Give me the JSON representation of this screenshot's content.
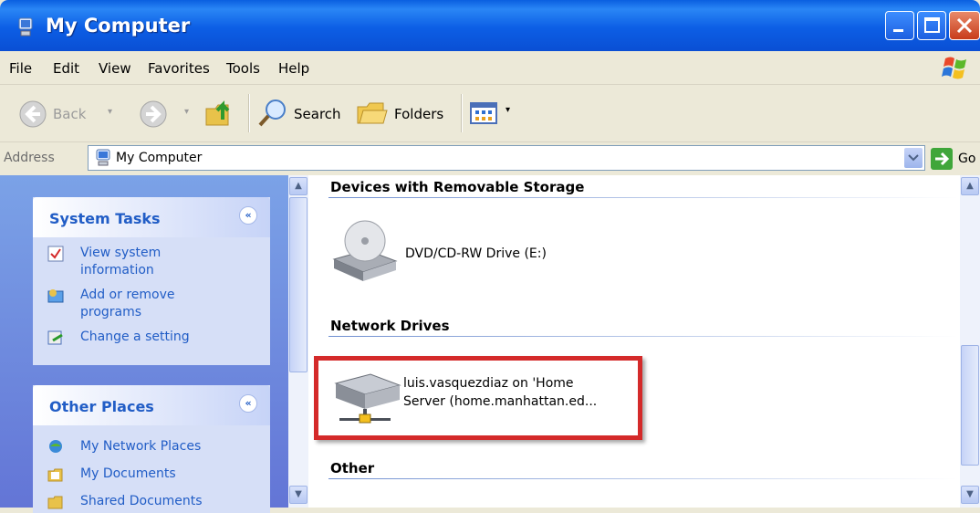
{
  "window": {
    "title": "My Computer"
  },
  "menu": [
    "File",
    "Edit",
    "View",
    "Favorites",
    "Tools",
    "Help"
  ],
  "toolbar": {
    "back": "Back",
    "search": "Search",
    "folders": "Folders"
  },
  "address": {
    "label": "Address",
    "value": "My Computer",
    "go": "Go"
  },
  "taskpane": {
    "system_tasks": {
      "title": "System Tasks",
      "items": [
        "View system information",
        "Add or remove programs",
        "Change a setting"
      ]
    },
    "other_places": {
      "title": "Other Places",
      "items": [
        "My Network Places",
        "My Documents",
        "Shared Documents"
      ]
    }
  },
  "groups": {
    "removable": {
      "title": "Devices with Removable Storage",
      "items": [
        {
          "label": "DVD/CD-RW Drive (E:)"
        }
      ]
    },
    "network": {
      "title": "Network Drives",
      "items": [
        {
          "line1": "luis.vasquezdiaz on 'Home",
          "line2": "Server (home.manhattan.ed..."
        }
      ]
    },
    "other": {
      "title": "Other"
    }
  },
  "colors": {
    "title_bar": "#0a5fe0",
    "highlight_border": "#d42a2a",
    "taskpane_link": "#215dc6"
  }
}
